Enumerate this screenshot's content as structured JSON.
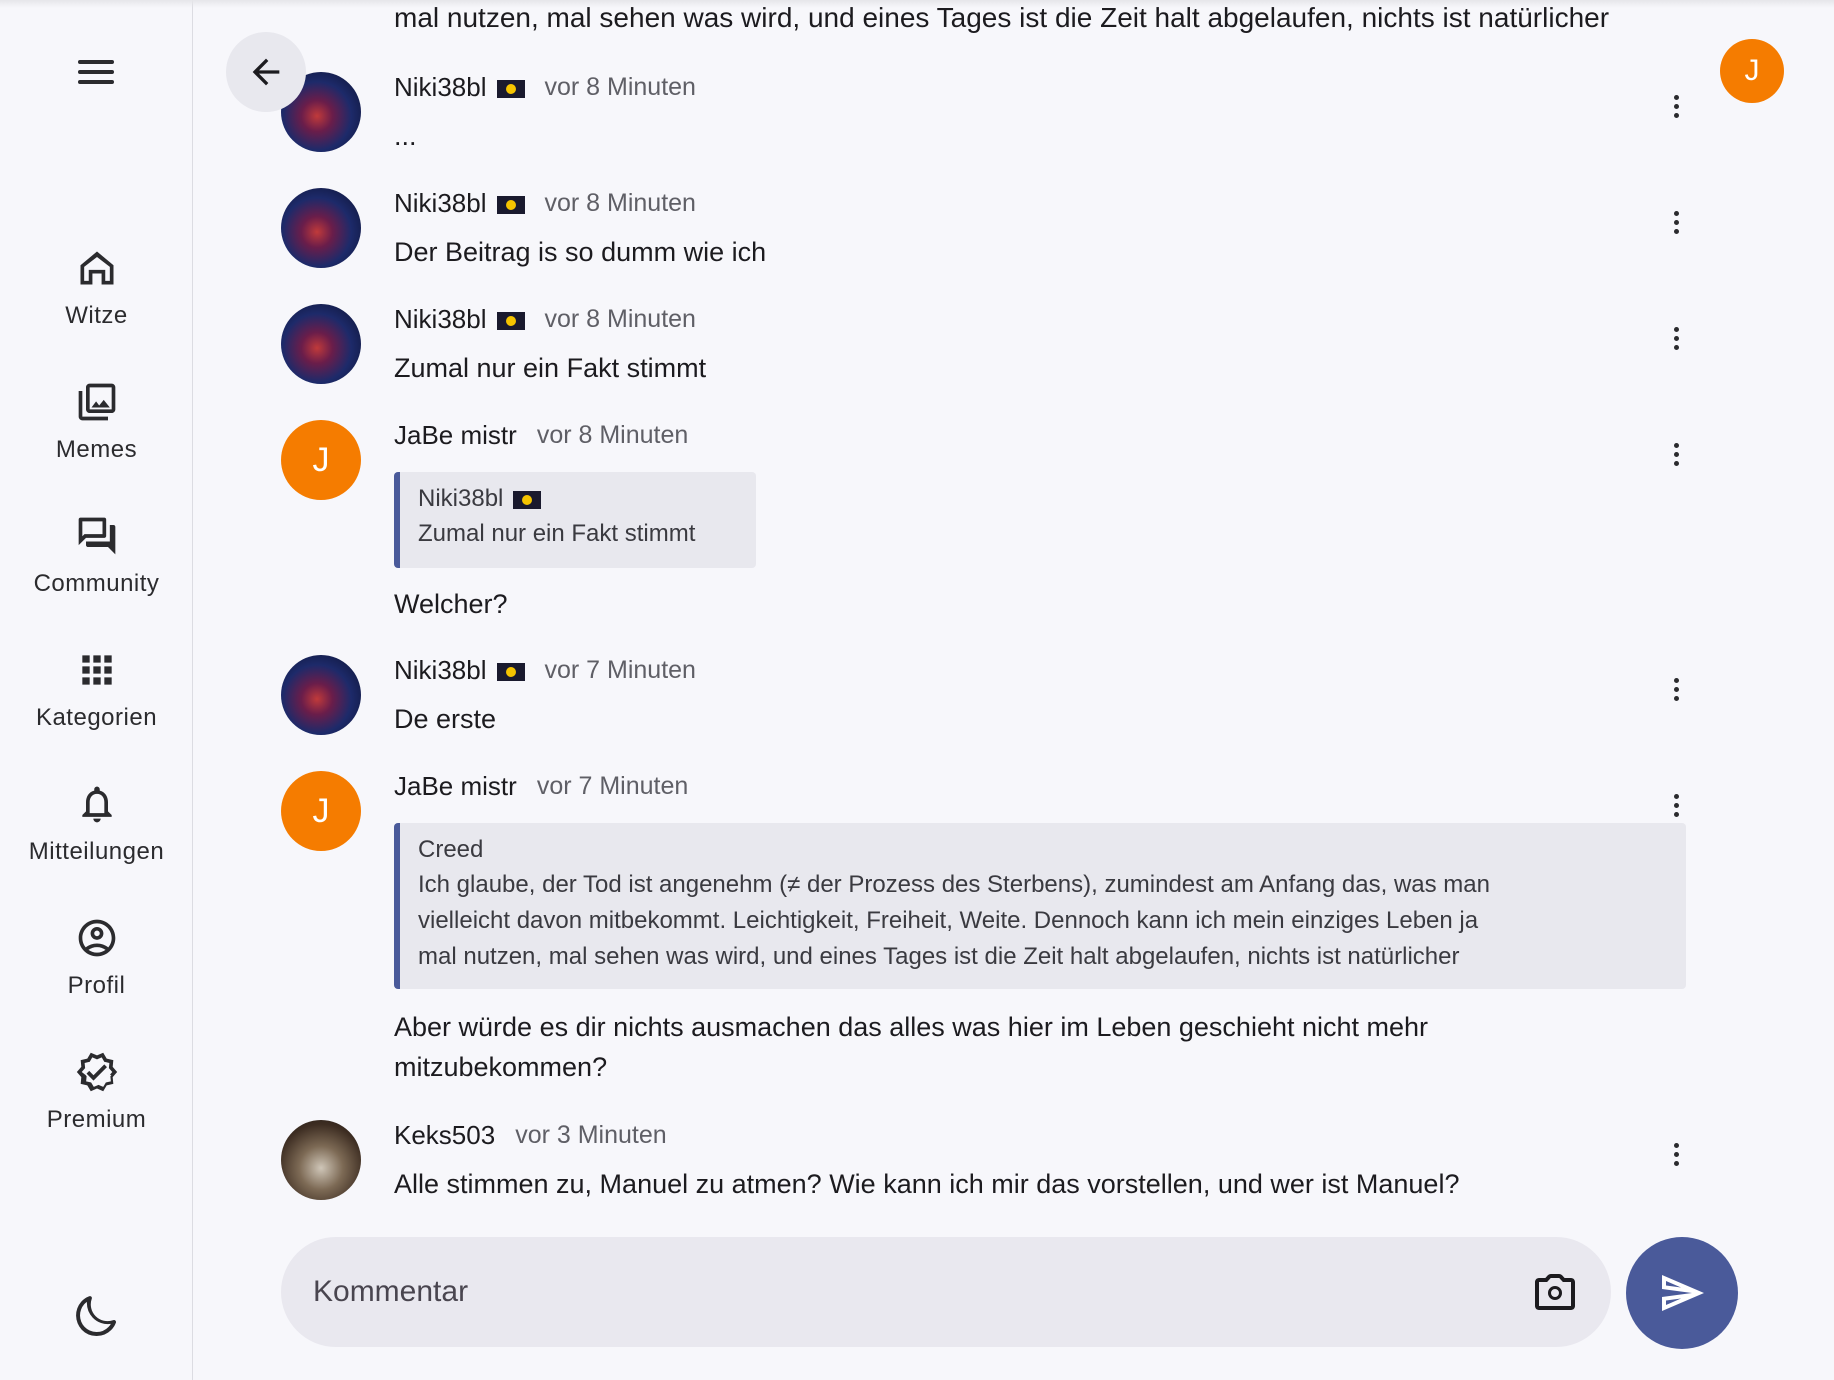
{
  "nav": {
    "items": [
      {
        "label": "Witze",
        "icon": "home-icon"
      },
      {
        "label": "Memes",
        "icon": "image-gallery-icon"
      },
      {
        "label": "Community",
        "icon": "forum-icon"
      },
      {
        "label": "Kategorien",
        "icon": "grid-icon"
      },
      {
        "label": "Mitteilungen",
        "icon": "bell-icon"
      },
      {
        "label": "Profil",
        "icon": "account-circle-icon"
      },
      {
        "label": "Premium",
        "icon": "verified-badge-icon"
      }
    ]
  },
  "header": {
    "user_initial": "J"
  },
  "thread": {
    "top_fragment": "mal nutzen, mal sehen was wird, und eines Tages ist die Zeit halt abgelaufen, nichts ist natürlicher",
    "comments": [
      {
        "author": "Niki38bl",
        "flag": true,
        "time": "vor 8 Minuten",
        "text": "..."
      },
      {
        "author": "Niki38bl",
        "flag": true,
        "time": "vor 8 Minuten",
        "text": "Der Beitrag is so dumm wie ich"
      },
      {
        "author": "Niki38bl",
        "flag": true,
        "time": "vor 8 Minuten",
        "text": "Zumal nur ein Fakt stimmt"
      },
      {
        "author": "JaBe mistr",
        "initial": "J",
        "time": "vor 8 Minuten",
        "quote": {
          "author": "Niki38bl",
          "text": "Zumal nur ein Fakt stimmt"
        },
        "text": "Welcher?"
      },
      {
        "author": "Niki38bl",
        "flag": true,
        "time": "vor 7 Minuten",
        "text": "De erste"
      },
      {
        "author": "JaBe mistr",
        "initial": "J",
        "time": "vor 7 Minuten",
        "quote": {
          "author": "Creed",
          "lines": [
            "Ich glaube, der Tod ist angenehm (≠ der Prozess des Sterbens), zumindest am Anfang das, was man",
            "vielleicht davon mitbekommt. Leichtigkeit, Freiheit, Weite. Dennoch kann ich mein einziges Leben ja",
            "mal nutzen, mal sehen was wird, und eines Tages ist die Zeit halt abgelaufen, nichts ist natürlicher"
          ]
        },
        "lines": [
          "Aber würde es dir nichts ausmachen das alles was hier im Leben geschieht nicht mehr",
          "mitzubekommen?"
        ]
      },
      {
        "author": "Keks503",
        "time": "vor 3 Minuten",
        "text": "Alle stimmen zu, Manuel zu atmen? Wie kann ich mir das vorstellen, und wer ist Manuel?"
      }
    ]
  },
  "composer": {
    "placeholder": "Kommentar"
  },
  "colors": {
    "accent": "#4a5a9a",
    "avatar_orange": "#f57c00",
    "background": "#f7f7fb"
  }
}
